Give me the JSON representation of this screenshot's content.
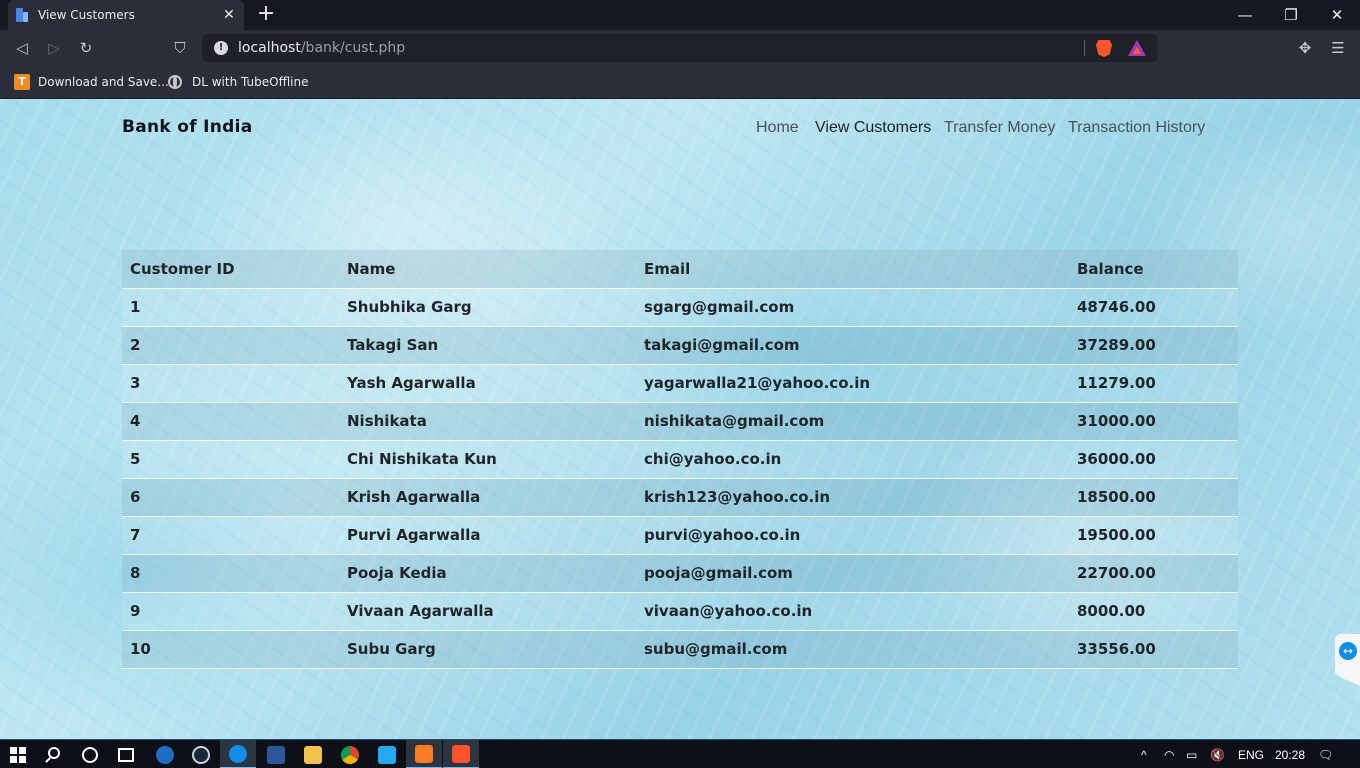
{
  "browser": {
    "tab_title": "View Customers",
    "tab_close": "✕",
    "new_tab": "+",
    "url_host": "localhost",
    "url_path": "/bank/cust.php",
    "window_controls": {
      "minimize": "—",
      "restore": "❐",
      "close": "✕"
    },
    "toolbar_glyphs": {
      "back": "◁",
      "forward": "▷",
      "reload": "↻",
      "bookmark": "⛉",
      "extensions": "✥",
      "menu": "☰"
    },
    "bookmarks": [
      {
        "label": "Download and Save...",
        "icon": "tubeoffline-t-icon",
        "glyph": "T"
      },
      {
        "label": "DL with TubeOffline",
        "icon": "globe-icon"
      }
    ]
  },
  "site": {
    "brand": "Bank of India",
    "nav": [
      {
        "label": "Home",
        "active": false
      },
      {
        "label": "View Customers",
        "active": true
      },
      {
        "label": "Transfer Money",
        "active": false
      },
      {
        "label": "Transaction History",
        "active": false
      }
    ]
  },
  "customers_table": {
    "headers": [
      "Customer ID",
      "Name",
      "Email",
      "Balance"
    ],
    "rows": [
      [
        "1",
        "Shubhika Garg",
        "sgarg@gmail.com",
        "48746.00"
      ],
      [
        "2",
        "Takagi San",
        "takagi@gmail.com",
        "37289.00"
      ],
      [
        "3",
        "Yash Agarwalla",
        "yagarwalla21@yahoo.co.in",
        "11279.00"
      ],
      [
        "4",
        "Nishikata",
        "nishikata@gmail.com",
        "31000.00"
      ],
      [
        "5",
        "Chi Nishikata Kun",
        "chi@yahoo.co.in",
        "36000.00"
      ],
      [
        "6",
        "Krish Agarwalla",
        "krish123@yahoo.co.in",
        "18500.00"
      ],
      [
        "7",
        "Purvi Agarwalla",
        "purvi@yahoo.co.in",
        "19500.00"
      ],
      [
        "8",
        "Pooja Kedia",
        "pooja@gmail.com",
        "22700.00"
      ],
      [
        "9",
        "Vivaan Agarwalla",
        "vivaan@yahoo.co.in",
        "8000.00"
      ],
      [
        "10",
        "Subu Garg",
        "subu@gmail.com",
        "33556.00"
      ]
    ]
  },
  "taskbar": {
    "apps": [
      "start-icon",
      "search-icon",
      "cortana-icon",
      "task-view-icon",
      "media-player-icon",
      "steam-icon",
      "teamviewer-icon",
      "word-icon",
      "file-explorer-icon",
      "chrome-icon",
      "vscode-icon",
      "xampp-icon",
      "brave-icon"
    ],
    "language": "ENG",
    "time": "20:28",
    "tray_glyphs": {
      "chevron": "^",
      "speaker": "🔇",
      "notification": "🗨"
    }
  },
  "colors": {
    "tab_bar": "#151823",
    "toolbar": "#2b2e38",
    "page_background": "#a6dcec",
    "table_text": "#1f2528",
    "taskbar": "#0d1117",
    "brave_orange": "#fb542b"
  }
}
